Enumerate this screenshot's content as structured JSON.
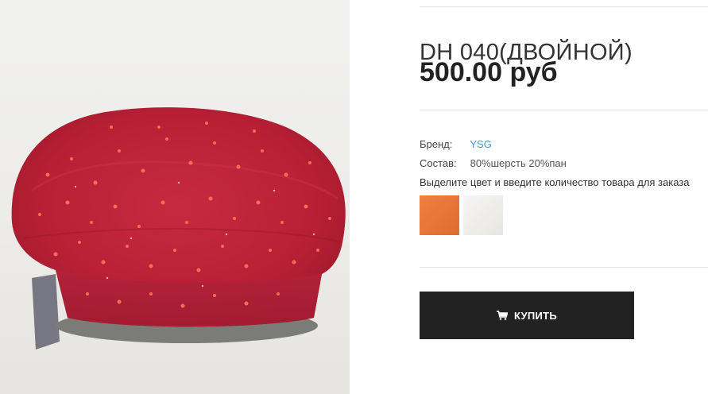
{
  "product": {
    "title": "DH 040(ДВОЙНОЙ)",
    "price": "500.00 руб",
    "image_icon": "red-beret-photo"
  },
  "attributes": {
    "brand_label": "Бренд:",
    "brand_value": "YSG",
    "composition_label": "Состав:",
    "composition_value": "80%шерсть 20%пан"
  },
  "colors": {
    "instruction": "Выделите цвет и введите количество товара для заказа",
    "swatches": [
      {
        "name": "orange",
        "color": "#e8763a"
      },
      {
        "name": "white",
        "color": "#f1f0ee"
      }
    ]
  },
  "cart": {
    "buy_label": "КУПИТЬ",
    "buy_icon": "cart-icon"
  },
  "theme": {
    "accent_link": "#3d9bd6",
    "button_bg": "#222222"
  }
}
